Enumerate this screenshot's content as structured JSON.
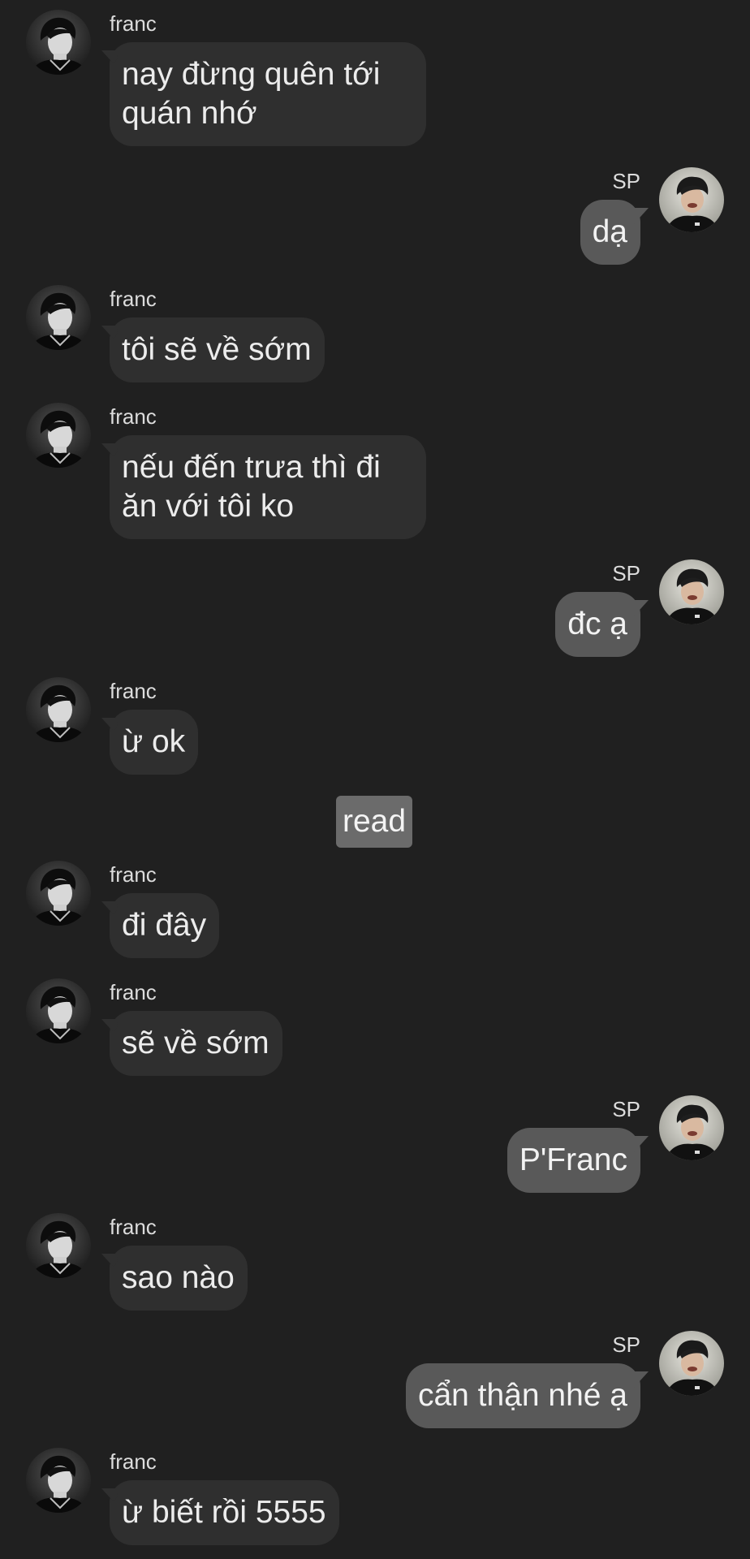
{
  "contacts": {
    "other": {
      "name": "franc",
      "avatar_icon": "franc-avatar-icon"
    },
    "self": {
      "name": "SP",
      "avatar_icon": "sp-avatar-icon"
    }
  },
  "colors": {
    "background": "#202020",
    "incoming_bubble": "#2f2f2f",
    "outgoing_bubble": "#595959",
    "status_badge": "#6b6b6b"
  },
  "messages": [
    {
      "from": "franc",
      "text": "nay đừng quên tới quán nhớ"
    },
    {
      "from": "SP",
      "text": "dạ"
    },
    {
      "from": "franc",
      "text": "tôi sẽ về sớm"
    },
    {
      "from": "franc",
      "text": "nếu đến trưa thì đi ăn với tôi ko"
    },
    {
      "from": "SP",
      "text": "đc ạ"
    },
    {
      "from": "franc",
      "text": "ừ ok"
    },
    {
      "from": "franc",
      "text": "đi đây"
    },
    {
      "from": "franc",
      "text": "sẽ về sớm"
    },
    {
      "from": "SP",
      "text": "P'Franc"
    },
    {
      "from": "franc",
      "text": "sao nào"
    },
    {
      "from": "SP",
      "text": "cẩn thận nhé ạ"
    },
    {
      "from": "franc",
      "text": "ừ biết rồi 5555"
    }
  ],
  "status": {
    "read_label": "read"
  }
}
